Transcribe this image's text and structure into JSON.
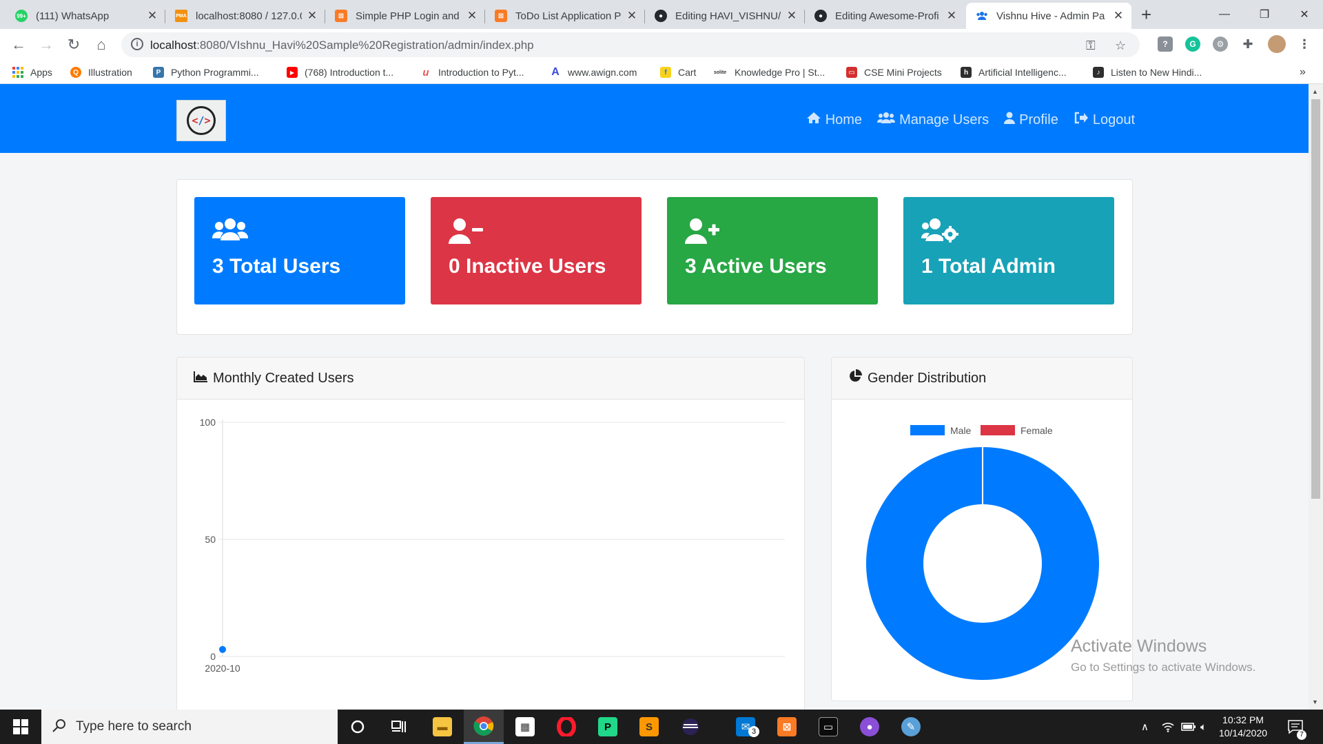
{
  "browser": {
    "tabs": [
      {
        "label": "(111) WhatsApp",
        "icon": "whatsapp-icon",
        "color": "#25d366",
        "badge": "99+"
      },
      {
        "label": "localhost:8080 / 127.0.0",
        "icon": "phpmyadmin-icon",
        "color": "#f29111",
        "badge": "PMA"
      },
      {
        "label": "Simple PHP Login and",
        "icon": "xampp-icon",
        "color": "#fb7a24",
        "badge": "⊠"
      },
      {
        "label": "ToDo List Application P",
        "icon": "xampp-icon",
        "color": "#fb7a24",
        "badge": "⊠"
      },
      {
        "label": "Editing HAVI_VISHNU/",
        "icon": "github-icon",
        "color": "#24292e",
        "badge": "●"
      },
      {
        "label": "Editing Awesome-Profi",
        "icon": "github-icon",
        "color": "#24292e",
        "badge": "●"
      },
      {
        "label": "Vishnu Hive - Admin Pa",
        "icon": "users-icon",
        "color": "#1a73e8",
        "badge": "●"
      }
    ],
    "url_host": "localhost",
    "url_path": ":8080/VIshnu_Havi%20Sample%20Registration/admin/index.php",
    "bookmarks": [
      {
        "label": "Apps",
        "icon": "apps-grid-icon",
        "color": "#ea4335"
      },
      {
        "label": "Illustration",
        "icon": "illustration-icon",
        "color": "#ff7a00"
      },
      {
        "label": "Python Programmi...",
        "icon": "python-icon",
        "color": "#3776ab"
      },
      {
        "label": "(768) Introduction t...",
        "icon": "youtube-icon",
        "color": "#ff0000"
      },
      {
        "label": "Introduction to Pyt...",
        "icon": "udemy-icon",
        "color": "#ec5252"
      },
      {
        "label": "www.awign.com",
        "icon": "awign-icon",
        "color": "#3a4bd8"
      },
      {
        "label": "Cart",
        "icon": "flipkart-icon",
        "color": "#f8d21b"
      },
      {
        "label": "Knowledge Pro | St...",
        "icon": "softla-icon",
        "color": "#555555"
      },
      {
        "label": "CSE Mini Projects",
        "icon": "projects-icon",
        "color": "#d32f2f"
      },
      {
        "label": "Artificial Intelligenc...",
        "icon": "hackerrank-icon",
        "color": "#2e2e2e"
      },
      {
        "label": "Listen to New Hindi...",
        "icon": "music-icon",
        "color": "#2e2e2e"
      }
    ],
    "more_bookmarks": "»"
  },
  "navbar": {
    "links": [
      {
        "label": "Home",
        "icon": "home-icon"
      },
      {
        "label": "Manage Users",
        "icon": "users-icon"
      },
      {
        "label": "Profile",
        "icon": "user-icon"
      },
      {
        "label": "Logout",
        "icon": "logout-icon"
      }
    ]
  },
  "stats": [
    {
      "text": "3 Total Users",
      "icon": "users-icon",
      "color": "#007bff"
    },
    {
      "text": "0 Inactive Users",
      "icon": "user-minus-icon",
      "color": "#dc3545"
    },
    {
      "text": "3 Active Users",
      "icon": "user-plus-icon",
      "color": "#28a745"
    },
    {
      "text": "1 Total Admin",
      "icon": "users-cog-icon",
      "color": "#17a2b8"
    }
  ],
  "monthly_card": {
    "title": "Monthly Created Users"
  },
  "gender_card": {
    "title": "Gender Distribution"
  },
  "chart_data": [
    {
      "type": "line",
      "title": "Monthly Created Users",
      "x": [
        "2020-10"
      ],
      "series": [
        {
          "values": [
            3
          ],
          "color": "#007bff"
        }
      ],
      "ylim": [
        0,
        100
      ],
      "yticks": [
        "100",
        "50",
        "0"
      ],
      "grid": true
    },
    {
      "type": "pie",
      "title": "Gender Distribution",
      "donut": true,
      "labels": [
        "Male",
        "Female"
      ],
      "values": [
        3,
        0
      ],
      "colors": [
        "#007bff",
        "#dc3545"
      ],
      "legend": "top"
    }
  ],
  "watermark": {
    "line1": "Activate Windows",
    "line2": "Go to Settings to activate Windows."
  },
  "taskbar": {
    "search_placeholder": "Type here to search",
    "time": "10:32 PM",
    "date": "10/14/2020",
    "mail_badge": "3",
    "notification_badge": "7"
  }
}
